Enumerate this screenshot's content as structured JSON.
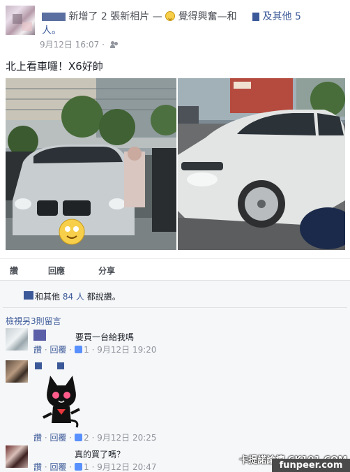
{
  "header": {
    "line1_prefix": "新增了 2 張新相片 — ",
    "line1_feeling": "覺得興奮—和",
    "line1_suffix": "及其他 5",
    "line2": "人。",
    "date": "9月12日 16:07 ·",
    "privacy_icon": "friends-icon"
  },
  "post": {
    "text": "北上看車囉！X6好帥"
  },
  "actions": {
    "like": "讚",
    "comment": "回應",
    "share": "分享"
  },
  "likes": {
    "prefix": "和其他",
    "count": "84 人",
    "suffix": "都說讚。"
  },
  "view_more": "檢視另3則留言",
  "comments": [
    {
      "text": "要買一台給我嗎",
      "like": "讚",
      "reply": "回覆",
      "likes": "1",
      "date": "9月12日 19:20"
    },
    {
      "text": "",
      "like": "讚",
      "reply": "回覆",
      "likes": "2",
      "date": "9月12日 20:25"
    },
    {
      "text": "真的買了嗎？",
      "like": "讚",
      "reply": "回覆",
      "likes": "1",
      "date": "9月12日 20:47"
    }
  ],
  "watermark": {
    "line1": "卡提諾論壇 CK101.COM",
    "line2": "funpeer.com"
  },
  "colors": {
    "link": "#3b5998",
    "meta": "#90949c",
    "panel": "#f6f7f9"
  }
}
